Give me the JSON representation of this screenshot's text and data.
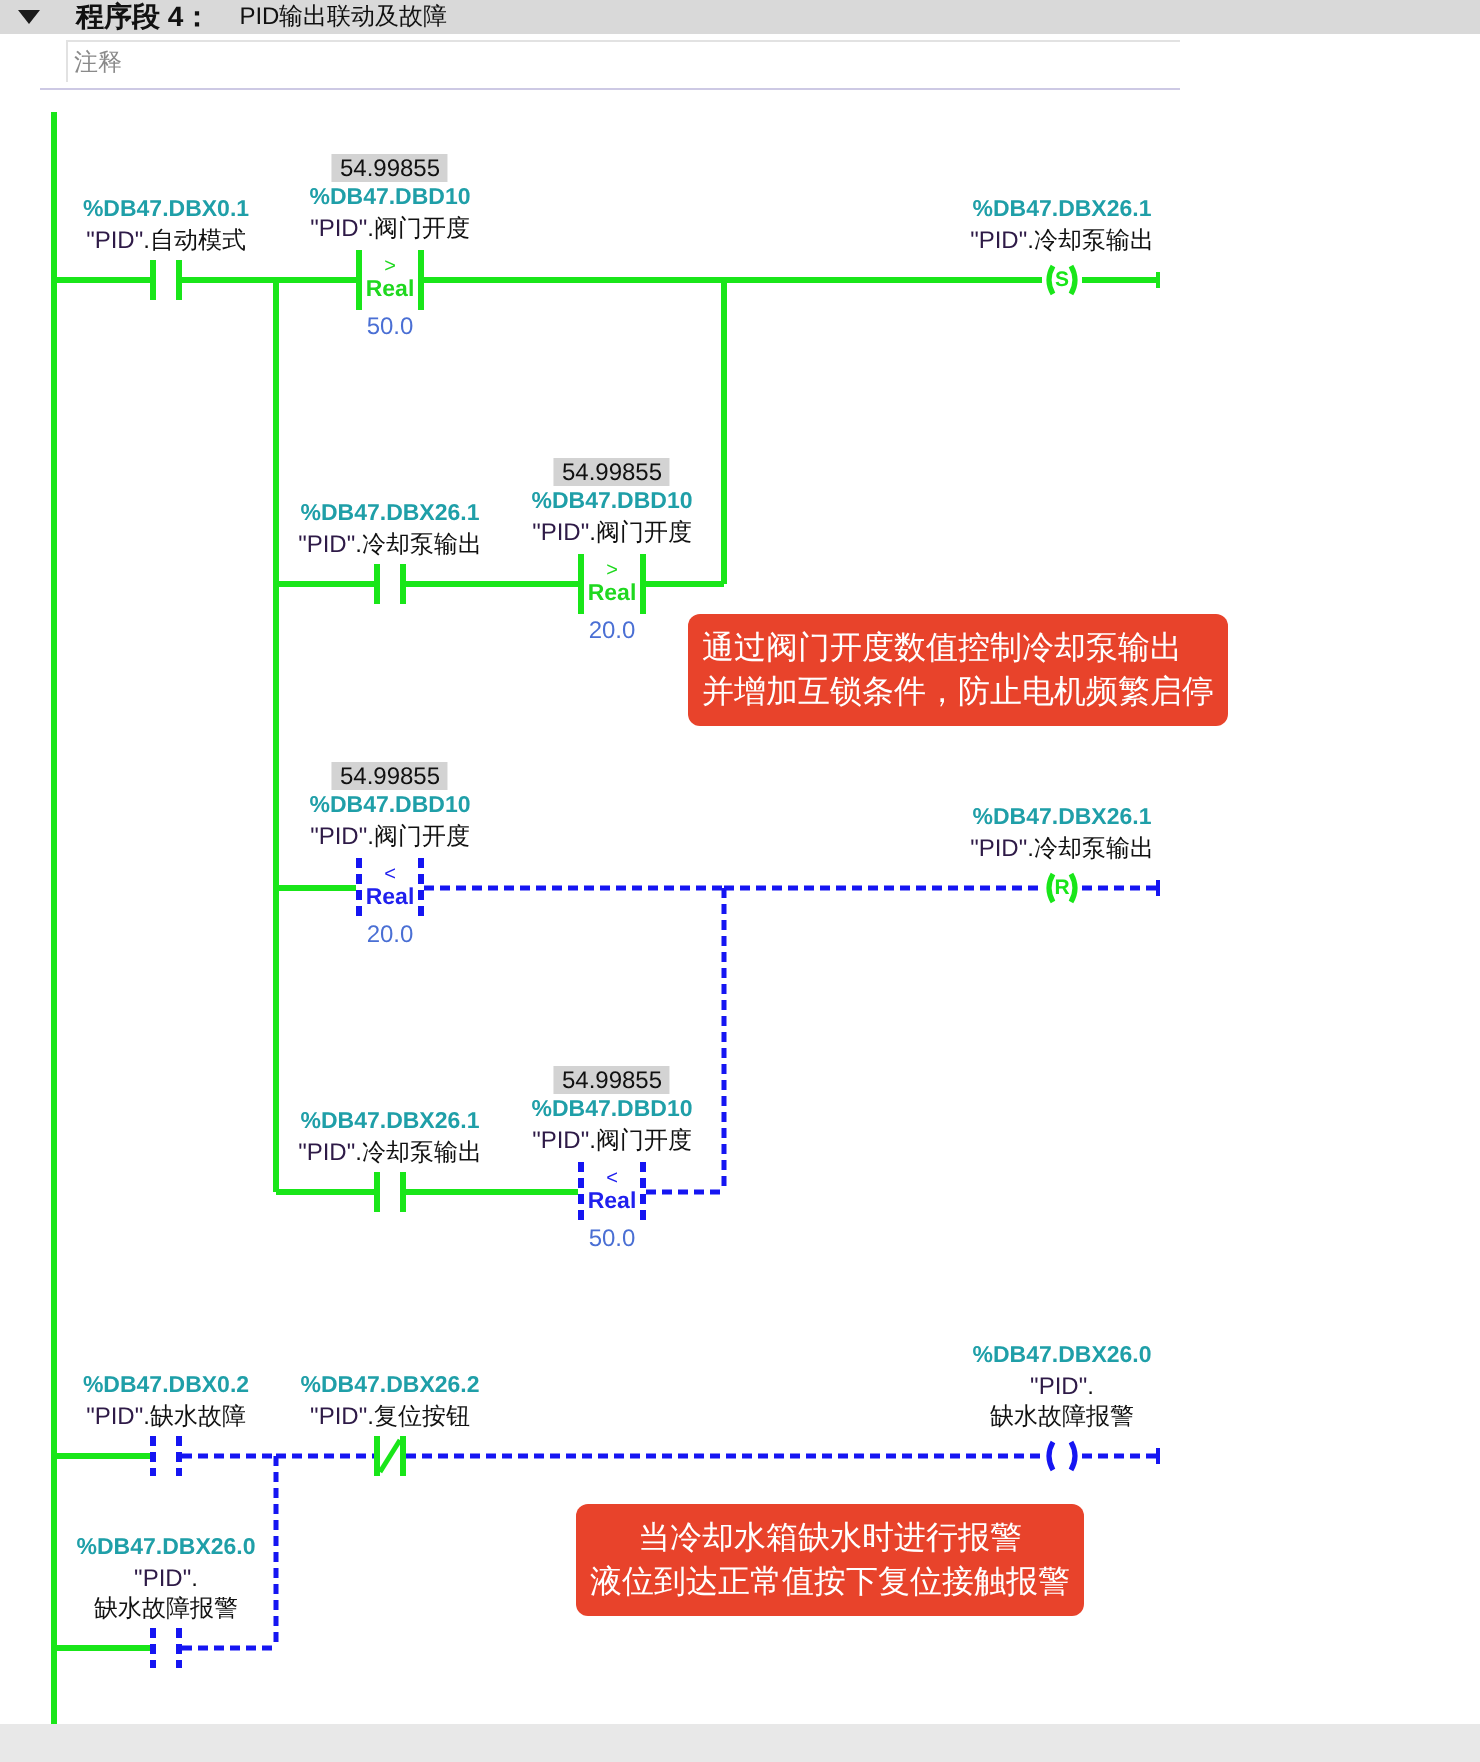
{
  "network": {
    "expanded": true,
    "label": "程序段 4：",
    "title": "PID输出联动及故障",
    "comment": {
      "placeholder": "注释"
    }
  },
  "rungs": [
    {
      "rows": [
        {
          "elements": [
            {
              "kind": "contact_no",
              "active": true,
              "address": "%DB47.DBX0.1",
              "block": "\"PID\"",
              "member": ".自动模式"
            },
            {
              "kind": "compare",
              "active": true,
              "monitor_value": "54.99855",
              "address": "%DB47.DBD10",
              "block": "\"PID\"",
              "member": ".阀门开度",
              "operator": ">",
              "data_type": "Real",
              "operand": "50.0"
            },
            {
              "kind": "coil",
              "active": true,
              "letter": "S",
              "address": "%DB47.DBX26.1",
              "block": "\"PID\"",
              "member": ".冷却泵输出"
            }
          ]
        },
        {
          "elements": [
            {
              "kind": "contact_no",
              "active": true,
              "address": "%DB47.DBX26.1",
              "block": "\"PID\"",
              "member": ".冷却泵输出"
            },
            {
              "kind": "compare",
              "active": true,
              "monitor_value": "54.99855",
              "address": "%DB47.DBD10",
              "block": "\"PID\"",
              "member": ".阀门开度",
              "operator": ">",
              "data_type": "Real",
              "operand": "20.0"
            }
          ]
        },
        {
          "elements": [
            {
              "kind": "compare",
              "active": false,
              "monitor_value": "54.99855",
              "address": "%DB47.DBD10",
              "block": "\"PID\"",
              "member": ".阀门开度",
              "operator": "<",
              "data_type": "Real",
              "operand": "20.0"
            },
            {
              "kind": "coil",
              "active": true,
              "letter": "R",
              "address": "%DB47.DBX26.1",
              "block": "\"PID\"",
              "member": ".冷却泵输出"
            }
          ]
        },
        {
          "elements": [
            {
              "kind": "contact_no",
              "active": true,
              "address": "%DB47.DBX26.1",
              "block": "\"PID\"",
              "member": ".冷却泵输出"
            },
            {
              "kind": "compare",
              "active": false,
              "monitor_value": "54.99855",
              "address": "%DB47.DBD10",
              "block": "\"PID\"",
              "member": ".阀门开度",
              "operator": "<",
              "data_type": "Real",
              "operand": "50.0"
            }
          ]
        }
      ]
    },
    {
      "rows": [
        {
          "elements": [
            {
              "kind": "contact_no",
              "active": false,
              "address": "%DB47.DBX0.2",
              "block": "\"PID\"",
              "member": ".缺水故障"
            },
            {
              "kind": "contact_nc",
              "active": true,
              "address": "%DB47.DBX26.2",
              "block": "\"PID\"",
              "member": ".复位按钮"
            },
            {
              "kind": "coil",
              "active": false,
              "address": "%DB47.DBX26.0",
              "block": "\"PID\"",
              "member": ".",
              "member_line2": "缺水故障报警"
            }
          ]
        },
        {
          "elements": [
            {
              "kind": "contact_no",
              "active": false,
              "address": "%DB47.DBX26.0",
              "block": "\"PID\"",
              "member": ".",
              "member_line2": "缺水故障报警"
            }
          ]
        }
      ]
    }
  ],
  "annotations": [
    {
      "lines": [
        "通过阀门开度数值控制冷却泵输出",
        "并增加互锁条件，防止电机频繁启停"
      ]
    },
    {
      "lines": [
        "当冷却水箱缺水时进行报警",
        "液位到达正常值按下复位接触报警"
      ]
    }
  ]
}
